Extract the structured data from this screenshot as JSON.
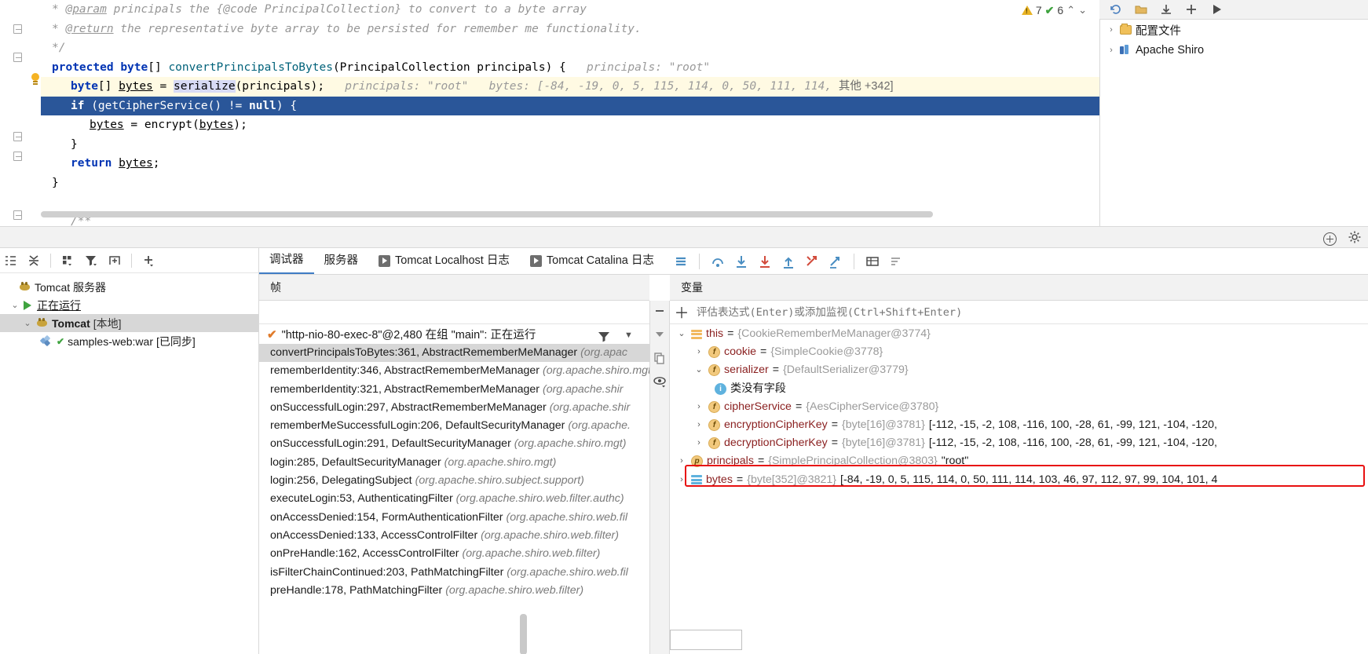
{
  "editor": {
    "lines": [
      {
        "id": "l1",
        "text": " * @param principals the {@code PrincipalCollection} to convert to a byte array"
      },
      {
        "id": "l2",
        "text": " * @return the representative byte array to be persisted for remember me functionality."
      },
      {
        "id": "l3",
        "text": " */"
      },
      {
        "id": "l4",
        "text": "protected byte[] convertPrincipalsToBytes(PrincipalCollection principals) {"
      },
      {
        "id": "l5",
        "text": "byte[] bytes = serialize(principals);"
      },
      {
        "id": "l6",
        "text": "if (getCipherService() != null) {"
      },
      {
        "id": "l7",
        "text": "bytes = encrypt(bytes);"
      },
      {
        "id": "l8",
        "text": "}"
      },
      {
        "id": "l9",
        "text": "return bytes;"
      },
      {
        "id": "l10",
        "text": "}"
      },
      {
        "id": "l11",
        "text": "/**"
      }
    ],
    "tokens": {
      "param_tag": "@param",
      "param_rest": " principals the {@code PrincipalCollection} to convert to a byte array",
      "return_tag": "@return",
      "return_rest": " the representative byte array to be persisted for remember me functionality.",
      "comment_close": "*/",
      "comment_open": "/**",
      "star": "*",
      "kw_protected": "protected",
      "kw_byte": "byte",
      "kw_if": "if",
      "kw_return": "return",
      "kw_null": "null",
      "brackets": "[]",
      "method_convert": "convertPrincipalsToBytes",
      "sig_params": "(PrincipalCollection principals) {",
      "var_bytes": "bytes",
      "eq": " = ",
      "call_serialize": "serialize",
      "serialize_args": "(principals);",
      "getcipher": " (getCipherService() != ",
      "if_close": ") {",
      "call_encrypt": "encrypt",
      "encrypt_args": "(",
      "encrypt_close": ");",
      "semi": ";",
      "brace_close": "}"
    },
    "inline_hints": {
      "principals_hint": "principals: \"root\"",
      "principals_hint2": "principals: \"root\"",
      "bytes_hint": "bytes: [-84, -19, 0, 5, 115, 114, 0, 50, 111, 114,",
      "bytes_hint_more": "其他 +342]"
    },
    "inspections": {
      "warning_count": "7",
      "check_count": "6",
      "up_arrow": "⌃",
      "down_arrow": "⌄"
    }
  },
  "right_toolbar": {
    "icons": [
      {
        "name": "refresh-icon",
        "glyph": "⟳"
      },
      {
        "name": "folder-open-icon",
        "glyph": "🗁"
      },
      {
        "name": "download-icon",
        "glyph": "⤓"
      },
      {
        "name": "add-icon",
        "glyph": "＋"
      },
      {
        "name": "run-icon",
        "glyph": "▶"
      }
    ]
  },
  "right_panel": {
    "items": [
      {
        "label": "配置文件",
        "icon": "folder-icon",
        "arrow": "›",
        "indent": 0
      },
      {
        "label": "Apache Shiro",
        "icon": "shiro-module-icon",
        "arrow": "›",
        "indent": 0
      }
    ]
  },
  "divider_strip": {
    "icons": [
      {
        "name": "collapse-circle-icon",
        "glyph": "⊖"
      },
      {
        "name": "settings-gear-icon",
        "glyph": "⚙"
      }
    ]
  },
  "services": {
    "toolbar_icons": [
      {
        "name": "expand-all-icon"
      },
      {
        "name": "collapse-all-icon"
      },
      {
        "name": "group-icon"
      },
      {
        "name": "filter-icon"
      },
      {
        "name": "add-frame-icon"
      },
      {
        "name": "add-service-icon"
      }
    ],
    "tree": [
      {
        "label": "Tomcat 服务器",
        "suffix": "",
        "icon": "tomcat-icon",
        "arrow": "",
        "indent": 0,
        "selected": false,
        "bold": false,
        "underline": false
      },
      {
        "label": "正在运行",
        "suffix": "",
        "icon": "run-triangle-icon",
        "arrow": "⌄",
        "indent": 1,
        "selected": false,
        "bold": false,
        "underline": true
      },
      {
        "label": "Tomcat",
        "suffix": " [本地]",
        "icon": "tomcat-icon",
        "arrow": "⌄",
        "indent": 2,
        "selected": true,
        "bold": true,
        "underline": false
      },
      {
        "label": "samples-web:war",
        "suffix": " [已同步]",
        "icon": "war-artifact-icon",
        "arrow": "",
        "indent": 3,
        "selected": false,
        "bold": false,
        "underline": false
      }
    ]
  },
  "debug_tabs": {
    "tabs": [
      {
        "label": "调试器",
        "active": true,
        "icon": ""
      },
      {
        "label": "服务器",
        "active": false,
        "icon": ""
      },
      {
        "label": "Tomcat Localhost 日志",
        "active": false,
        "icon": "console-play-icon"
      },
      {
        "label": "Tomcat Catalina 日志",
        "active": false,
        "icon": "console-play-icon"
      }
    ],
    "actions": [
      {
        "name": "layout-icon",
        "glyph": "≡",
        "color": "#3f7cc4"
      },
      {
        "name": "step-over-icon",
        "glyph": "⤴",
        "color": "#3f7cc4"
      },
      {
        "name": "step-into-icon",
        "glyph": "⤓",
        "color": "#3f7cc4"
      },
      {
        "name": "force-step-into-icon",
        "glyph": "⤓",
        "color": "#d24b3c"
      },
      {
        "name": "step-out-icon",
        "glyph": "⤒",
        "color": "#3f7cc4"
      },
      {
        "name": "drop-frame-icon",
        "glyph": "↗",
        "color": "#d24b3c"
      },
      {
        "name": "run-to-cursor-icon",
        "glyph": "⇥",
        "color": "#3f7cc4"
      },
      {
        "name": "evaluate-table-icon",
        "glyph": "▦",
        "color": "#4a4a4a"
      },
      {
        "name": "sort-values-icon",
        "glyph": "⇅",
        "color": "#4a4a4a"
      }
    ]
  },
  "frames": {
    "header": "帧",
    "thread": "\"http-nio-80-exec-8\"@2,480 在组 \"main\": 正在运行",
    "filter_icon": "filter-icon",
    "caret_icon": "chevron-down-icon",
    "rows": [
      {
        "method": "convertPrincipalsToBytes:361, AbstractRememberMeManager",
        "pkg": "(org.apac",
        "selected": true
      },
      {
        "method": "rememberIdentity:346, AbstractRememberMeManager",
        "pkg": "(org.apache.shiro.mgt)",
        "selected": false
      },
      {
        "method": "rememberIdentity:321, AbstractRememberMeManager",
        "pkg": "(org.apache.shir",
        "selected": false
      },
      {
        "method": "onSuccessfulLogin:297, AbstractRememberMeManager",
        "pkg": "(org.apache.shir",
        "selected": false
      },
      {
        "method": "rememberMeSuccessfulLogin:206, DefaultSecurityManager",
        "pkg": "(org.apache.",
        "selected": false
      },
      {
        "method": "onSuccessfulLogin:291, DefaultSecurityManager",
        "pkg": "(org.apache.shiro.mgt)",
        "selected": false
      },
      {
        "method": "login:285, DefaultSecurityManager",
        "pkg": "(org.apache.shiro.mgt)",
        "selected": false
      },
      {
        "method": "login:256, DelegatingSubject",
        "pkg": "(org.apache.shiro.subject.support)",
        "selected": false
      },
      {
        "method": "executeLogin:53, AuthenticatingFilter",
        "pkg": "(org.apache.shiro.web.filter.authc)",
        "selected": false
      },
      {
        "method": "onAccessDenied:154, FormAuthenticationFilter",
        "pkg": "(org.apache.shiro.web.fil",
        "selected": false
      },
      {
        "method": "onAccessDenied:133, AccessControlFilter",
        "pkg": "(org.apache.shiro.web.filter)",
        "selected": false
      },
      {
        "method": "onPreHandle:162, AccessControlFilter",
        "pkg": "(org.apache.shiro.web.filter)",
        "selected": false
      },
      {
        "method": "isFilterChainContinued:203, PathMatchingFilter",
        "pkg": "(org.apache.shiro.web.fil",
        "selected": false
      },
      {
        "method": "preHandle:178, PathMatchingFilter",
        "pkg": "(org.apache.shiro.web.filter)",
        "selected": false
      }
    ]
  },
  "mid_strip": {
    "icons": [
      {
        "name": "minus-icon",
        "glyph": "−"
      },
      {
        "name": "chevron-down-filled-icon",
        "glyph": "▼"
      },
      {
        "name": "copy-icon",
        "glyph": "🗐"
      },
      {
        "name": "watch-eye-icon",
        "glyph": "◉"
      }
    ]
  },
  "variables": {
    "header": "变量",
    "eval_placeholder": "评估表达式(Enter)或添加监视(Ctrl+Shift+Enter)",
    "add_icon": "plus-icon",
    "rows": [
      {
        "indent": 0,
        "arrow": "⌄",
        "badge": "obj",
        "name": "this",
        "eq": " = ",
        "type": "{CookieRememberMeManager@3774}",
        "value": "",
        "highlighted": false,
        "underline": false
      },
      {
        "indent": 1,
        "arrow": "›",
        "badge": "f",
        "name": "cookie",
        "eq": " = ",
        "type": "{SimpleCookie@3778}",
        "value": "",
        "highlighted": false,
        "underline": false
      },
      {
        "indent": 1,
        "arrow": "⌄",
        "badge": "f",
        "name": "serializer",
        "eq": " = ",
        "type": "{DefaultSerializer@3779}",
        "value": "",
        "highlighted": false,
        "underline": false
      },
      {
        "indent": 2,
        "arrow": "",
        "badge": "info",
        "name": "",
        "eq": "",
        "type": "",
        "value": "类没有字段",
        "highlighted": false,
        "underline": false
      },
      {
        "indent": 1,
        "arrow": "›",
        "badge": "f",
        "name": "cipherService",
        "eq": " = ",
        "type": "{AesCipherService@3780}",
        "value": "",
        "highlighted": false,
        "underline": false
      },
      {
        "indent": 1,
        "arrow": "›",
        "badge": "f",
        "name": "encryptionCipherKey",
        "eq": " = ",
        "type": "{byte[16]@3781}",
        "value": "[-112, -15, -2, 108, -116, 100, -28, 61, -99, 121, -104, -120,",
        "highlighted": false,
        "underline": false
      },
      {
        "indent": 1,
        "arrow": "›",
        "badge": "f",
        "name": "decryptionCipherKey",
        "eq": " = ",
        "type": "{byte[16]@3781}",
        "value": "[-112, -15, -2, 108, -116, 100, -28, 61, -99, 121, -104, -120,",
        "highlighted": false,
        "underline": false
      },
      {
        "indent": 0,
        "arrow": "›",
        "badge": "p",
        "name": "principals",
        "eq": " = ",
        "type": "{SimplePrincipalCollection@3803}",
        "value": "\"root\"",
        "highlighted": false,
        "underline": true
      },
      {
        "indent": 0,
        "arrow": "›",
        "badge": "arr",
        "name": "bytes",
        "eq": " = ",
        "type": "{byte[352]@3821}",
        "value": "[-84, -19, 0, 5, 115, 114, 0, 50, 111, 114, 103, 46, 97, 112, 97, 99, 104, 101, 4",
        "highlighted": true,
        "underline": false
      }
    ],
    "highlight_color": "#e81010"
  },
  "colors": {
    "accent_blue": "#3f7cc4",
    "exec_line": "#2a5699",
    "current_line": "#fffae3",
    "selection_grey": "#d7d7d7",
    "toolbar_bg": "#f2f2f2",
    "red_highlight": "#e81010"
  }
}
